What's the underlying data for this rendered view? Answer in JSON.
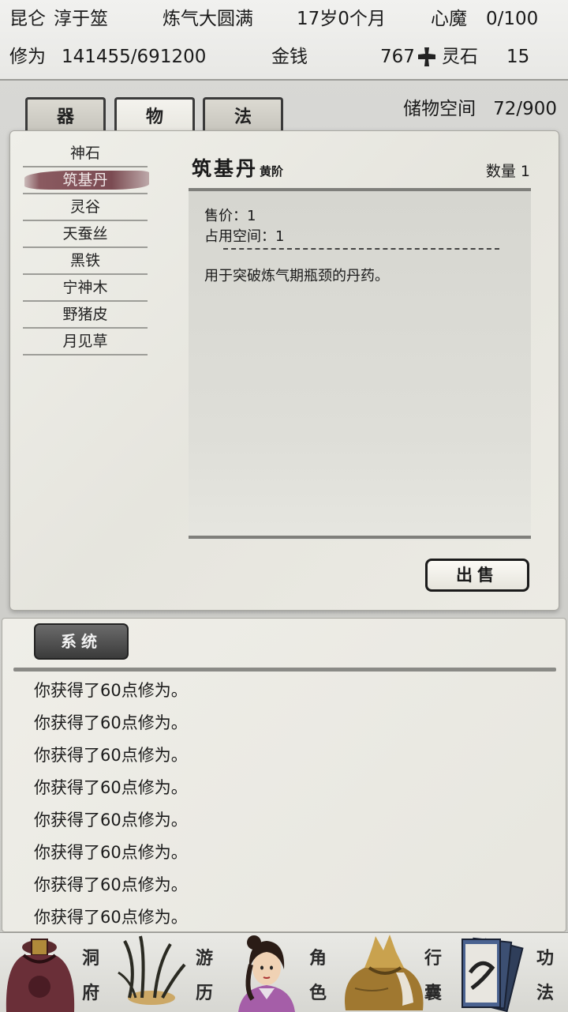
{
  "header": {
    "location": "昆仑",
    "name": "淳于筮",
    "realm": "炼气大圆满",
    "age": "17岁0个月",
    "heart_demon_label": "心魔",
    "heart_demon_value": "0/100",
    "cultivation_label": "修为",
    "cultivation_value": "141455/691200",
    "money_label": "金钱",
    "money_value": "767",
    "spirit_stone_label": "灵石",
    "spirit_stone_value": "15"
  },
  "tabs": [
    {
      "label": "器"
    },
    {
      "label": "物"
    },
    {
      "label": "法"
    }
  ],
  "active_tab": 1,
  "storage": {
    "label": "储物空间",
    "value": "72/900"
  },
  "items": [
    {
      "label": "神石"
    },
    {
      "label": "筑基丹"
    },
    {
      "label": "灵谷"
    },
    {
      "label": "天蚕丝"
    },
    {
      "label": "黑铁"
    },
    {
      "label": "宁神木"
    },
    {
      "label": "野猪皮"
    },
    {
      "label": "月见草"
    }
  ],
  "selected_item": 1,
  "detail": {
    "name": "筑基丹",
    "grade": "黄阶",
    "quantity": "数量 1",
    "price": "售价：1",
    "space": "占用空间：1",
    "separator": "----------------------------",
    "description": "用于突破炼气期瓶颈的丹药。",
    "sell_label": "出售"
  },
  "log": {
    "tab_label": "系统",
    "lines": [
      "你获得了60点修为。",
      "你获得了60点修为。",
      "你获得了60点修为。",
      "你获得了60点修为。",
      "你获得了60点修为。",
      "你获得了60点修为。",
      "你获得了60点修为。",
      "你获得了60点修为。"
    ]
  },
  "nav": [
    {
      "top": "洞",
      "bottom": "府",
      "icon": "treasure-bag-icon"
    },
    {
      "top": "游",
      "bottom": "历",
      "icon": "herb-icon"
    },
    {
      "top": "角",
      "bottom": "色",
      "icon": "character-portrait-icon"
    },
    {
      "top": "行",
      "bottom": "囊",
      "icon": "cloth-bundle-icon"
    },
    {
      "top": "功",
      "bottom": "法",
      "icon": "scroll-books-icon"
    }
  ],
  "colors": {
    "selected_item_brush": "#7b4b52",
    "log_tab_bg": "#4a4a4a",
    "panel_bg": "#ecebe4"
  }
}
